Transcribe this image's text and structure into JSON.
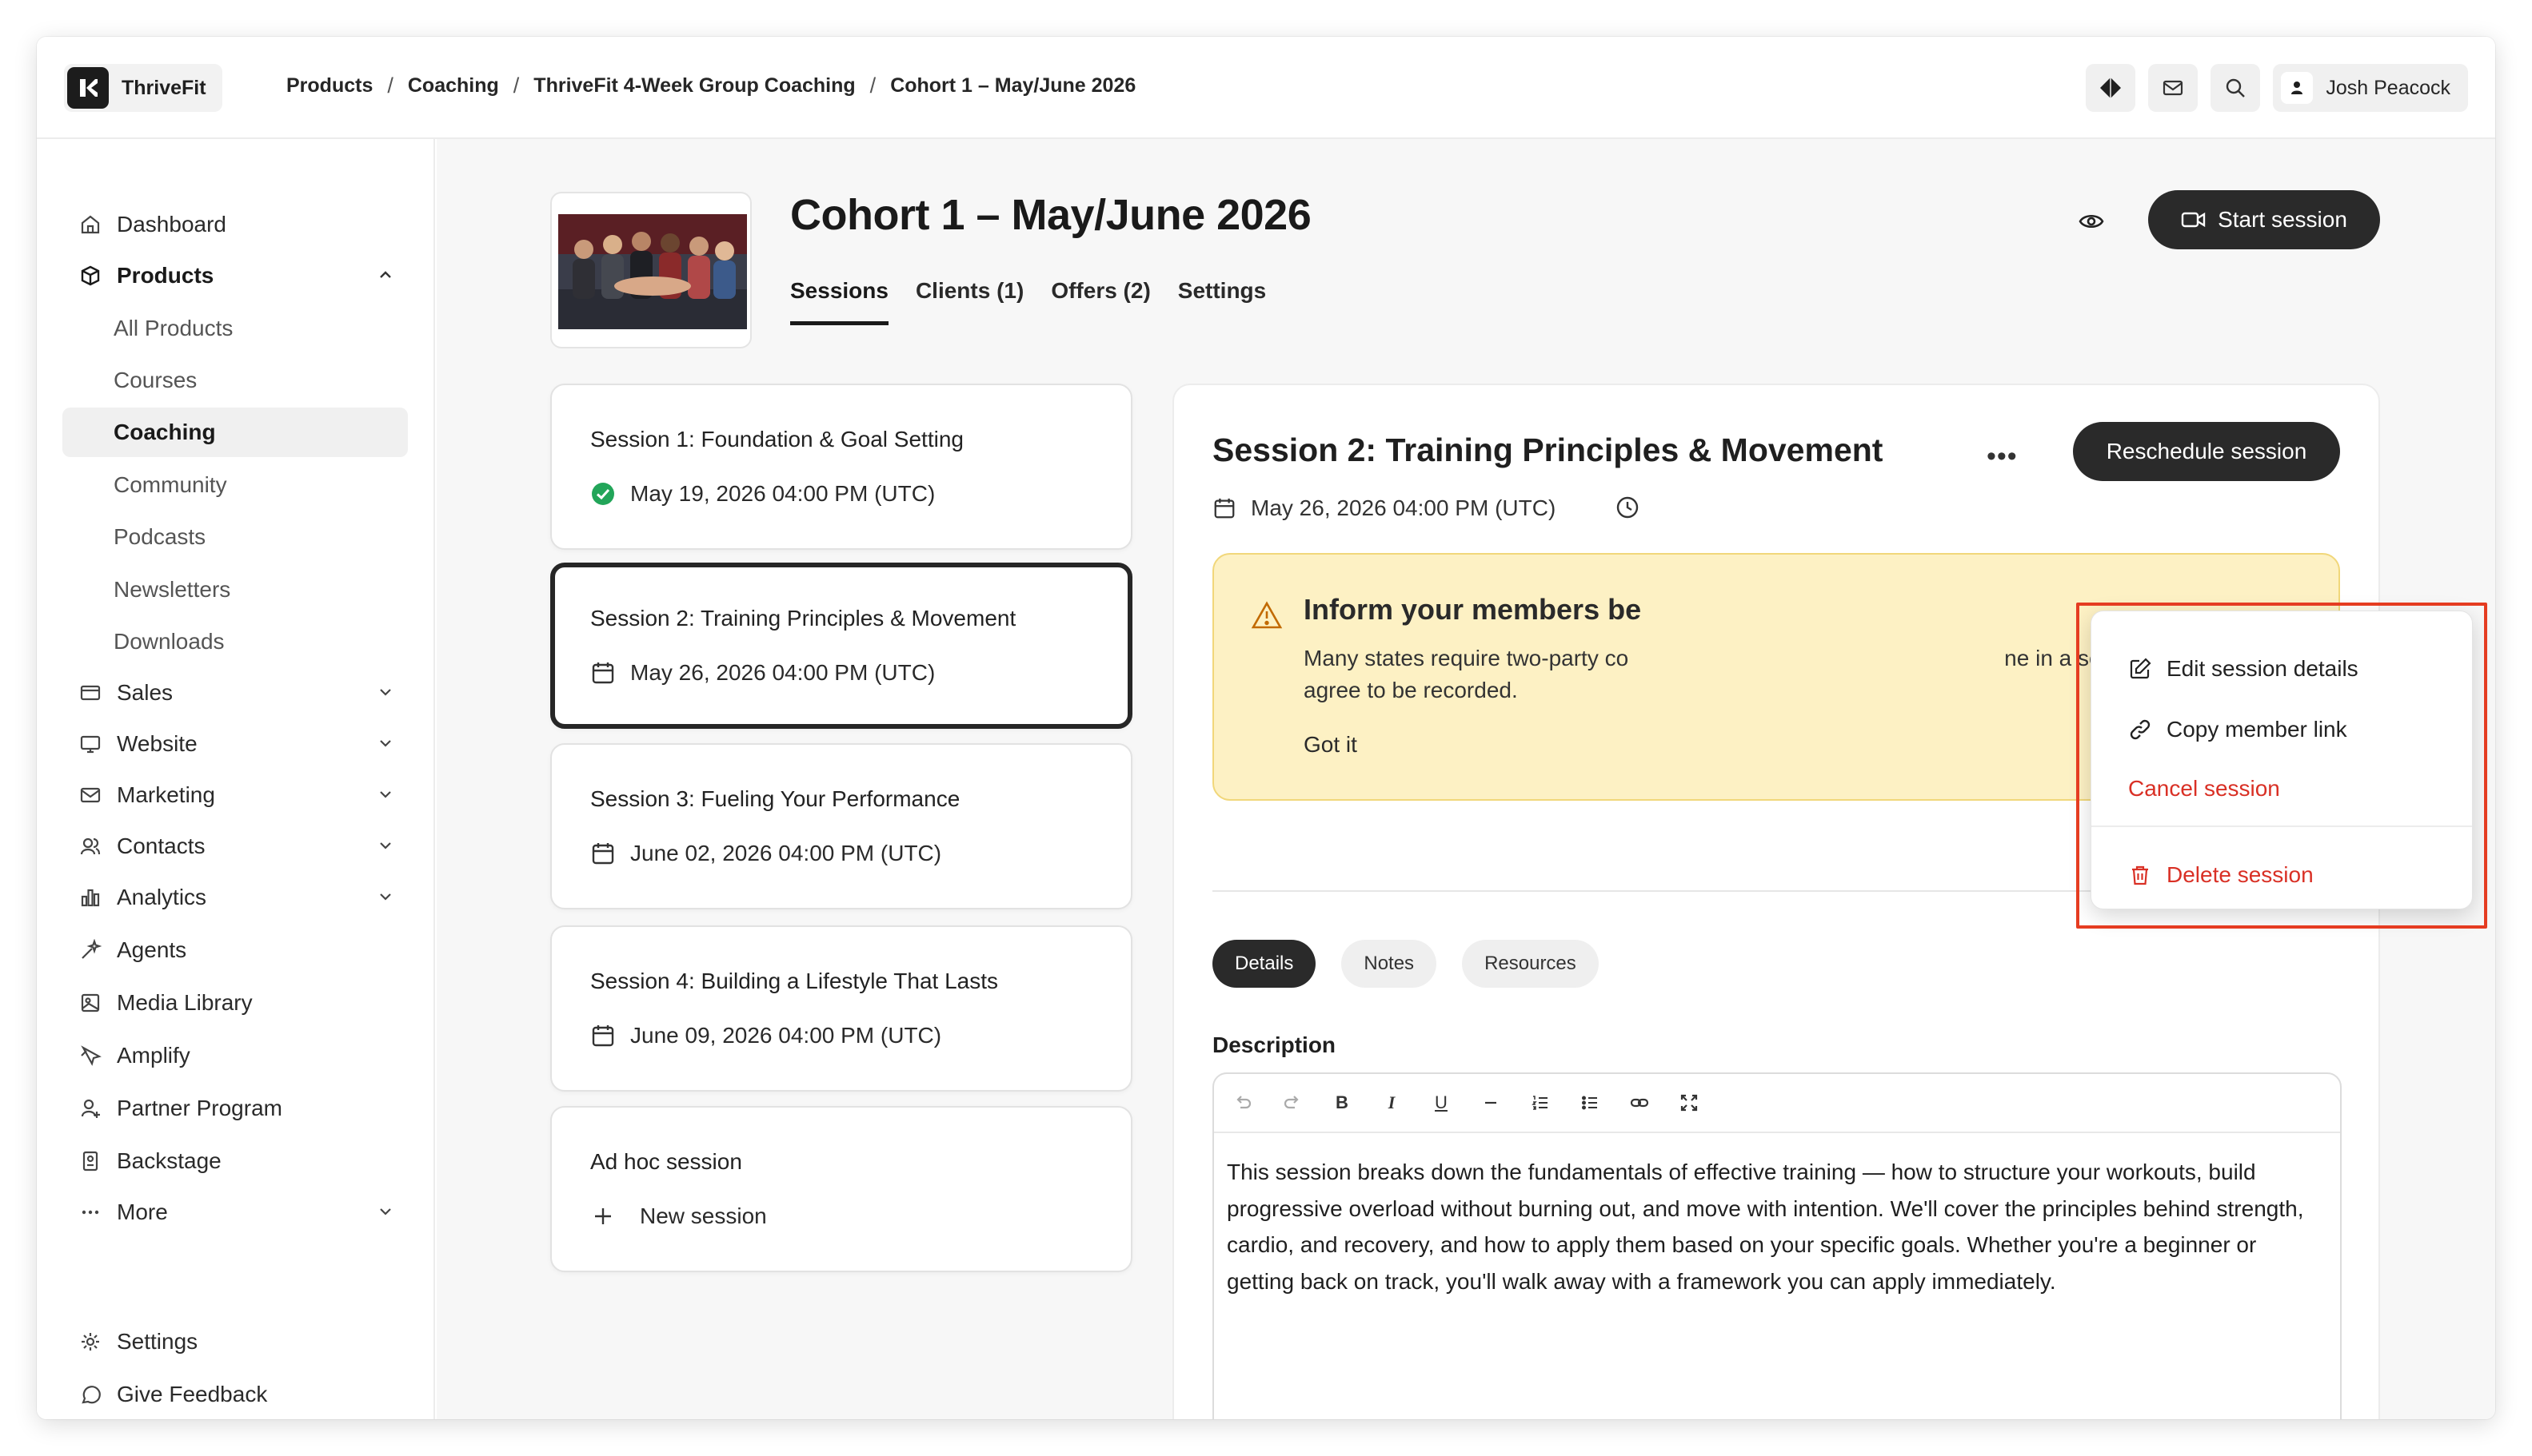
{
  "brand": {
    "name": "ThriveFit"
  },
  "breadcrumb": [
    "Products",
    "Coaching",
    "ThriveFit 4-Week Group Coaching",
    "Cohort 1 – May/June 2026"
  ],
  "user": {
    "name": "Josh Peacock"
  },
  "sidebar": {
    "dashboard": "Dashboard",
    "products": "Products",
    "products_sub": [
      "All Products",
      "Courses",
      "Coaching",
      "Community",
      "Podcasts",
      "Newsletters",
      "Downloads"
    ],
    "sales": "Sales",
    "website": "Website",
    "marketing": "Marketing",
    "contacts": "Contacts",
    "analytics": "Analytics",
    "agents": "Agents",
    "media_library": "Media Library",
    "amplify": "Amplify",
    "partner_program": "Partner Program",
    "backstage": "Backstage",
    "more": "More",
    "settings": "Settings",
    "feedback": "Give Feedback"
  },
  "header": {
    "title": "Cohort 1 – May/June 2026",
    "tabs": [
      "Sessions",
      "Clients (1)",
      "Offers (2)",
      "Settings"
    ],
    "start_session": "Start session"
  },
  "sessions": [
    {
      "title": "Session 1: Foundation & Goal Setting",
      "date": "May 19, 2026 04:00 PM (UTC)",
      "status": "completed"
    },
    {
      "title": "Session 2: Training Principles & Movement",
      "date": "May 26, 2026 04:00 PM (UTC)",
      "status": "scheduled"
    },
    {
      "title": "Session 3: Fueling Your Performance",
      "date": "June 02, 2026 04:00 PM (UTC)",
      "status": "scheduled"
    },
    {
      "title": "Session 4: Building a Lifestyle That Lasts",
      "date": "June 09, 2026 04:00 PM (UTC)",
      "status": "scheduled"
    }
  ],
  "adhoc": {
    "title": "Ad hoc session",
    "new_label": "New session"
  },
  "detail": {
    "title": "Session 2: Training Principles & Movement",
    "date": "May 26, 2026 04:00 PM (UTC)",
    "reschedule": "Reschedule session",
    "alert": {
      "title_start": "Inform your members be",
      "text_start": "Many states require two-party co",
      "text_end": "ne in a session must",
      "text_line2": "agree to be recorded.",
      "got_it": "Got it"
    },
    "pills": [
      "Details",
      "Notes",
      "Resources"
    ],
    "description_label": "Description",
    "description": "This session breaks down the fundamentals of effective training — how to structure your workouts, build progressive overload without burning out, and move with intention. We'll cover the principles behind strength, cardio, and recovery, and how to apply them based on your specific goals. Whether you're a beginner or getting back on track, you'll walk away with a framework you can apply immediately."
  },
  "menu": {
    "edit": "Edit session details",
    "copy": "Copy member link",
    "cancel": "Cancel session",
    "delete": "Delete session"
  },
  "colors": {
    "accent_dark": "#2a2a2a",
    "danger": "#d93025",
    "alert_bg": "#fdf1c4",
    "success": "#22a559",
    "highlight": "#e53c21"
  }
}
